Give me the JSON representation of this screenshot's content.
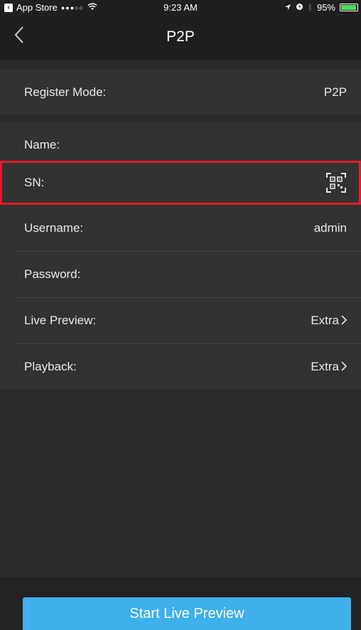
{
  "status_bar": {
    "back_app": "App Store",
    "signal": "●●●○○",
    "wifi": "wifi",
    "time": "9:23 AM",
    "battery_percent": "95%",
    "battery_level": 0.95
  },
  "nav": {
    "back_icon": "chevron-left-icon",
    "title": "P2P"
  },
  "form": {
    "register_mode": {
      "label": "Register Mode:",
      "value": "P2P"
    },
    "name": {
      "label": "Name:",
      "value": ""
    },
    "sn": {
      "label": "SN:",
      "value": "",
      "icon": "qr-code-icon"
    },
    "username": {
      "label": "Username:",
      "value": "admin"
    },
    "password": {
      "label": "Password:",
      "value": ""
    },
    "live_preview": {
      "label": "Live Preview:",
      "value": "Extra"
    },
    "playback": {
      "label": "Playback:",
      "value": "Extra"
    }
  },
  "actions": {
    "start_live_preview": "Start Live Preview"
  },
  "colors": {
    "accent": "#3fb0ea",
    "highlight_border": "#e21b2b",
    "background": "#2b2b2b",
    "row_background": "#323232"
  }
}
